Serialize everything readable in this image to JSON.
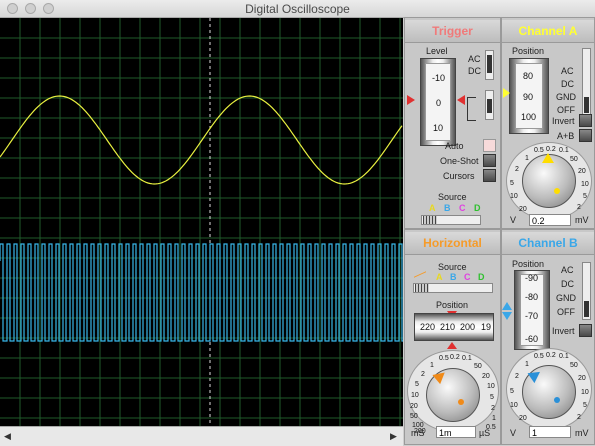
{
  "window": {
    "title": "Digital Oscilloscope"
  },
  "trigger": {
    "title": "Trigger",
    "level_label": "Level",
    "level_ticks": [
      "-10",
      "0",
      "10"
    ],
    "ac_label": "AC",
    "dc_label": "DC",
    "auto_label": "Auto",
    "oneshot_label": "One-Shot",
    "cursors_label": "Cursors",
    "source_label": "Source",
    "sources": [
      "A",
      "B",
      "C",
      "D"
    ]
  },
  "channel_a": {
    "title": "Channel A",
    "position_label": "Position",
    "position_ticks": [
      "80",
      "90",
      "100"
    ],
    "coupling": [
      "AC",
      "DC",
      "GND",
      "OFF"
    ],
    "invert_label": "Invert",
    "aplusb_label": "A+B",
    "scale": [
      "0.5",
      "0.2",
      "0.1",
      "1",
      "50",
      "2",
      "20",
      "5",
      "10",
      "10",
      "5",
      "20",
      "2"
    ],
    "unit_left": "V",
    "unit_right": "mV",
    "value": "0.2"
  },
  "horizontal": {
    "title": "Horizontal",
    "source_label": "Source",
    "sources": [
      "A",
      "B",
      "C",
      "D"
    ],
    "position_label": "Position",
    "position_ticks": [
      "220",
      "210",
      "200",
      "19"
    ],
    "scale": [
      "0.5",
      "0.2",
      "0.1",
      "1",
      "50",
      "2",
      "20",
      "5",
      "10",
      "10",
      "5",
      "20",
      "2",
      "50",
      "1",
      "100",
      "0.5",
      "200"
    ],
    "unit_left": "mS",
    "unit_right": "µS",
    "value": "1m"
  },
  "channel_b": {
    "title": "Channel B",
    "position_label": "Position",
    "position_ticks": [
      "-90",
      "-80",
      "-70",
      "-60"
    ],
    "coupling": [
      "AC",
      "DC",
      "GND",
      "OFF"
    ],
    "invert_label": "Invert",
    "scale": [
      "0.5",
      "0.2",
      "0.1",
      "1",
      "50",
      "2",
      "20",
      "5",
      "10",
      "10",
      "5",
      "20",
      "2"
    ],
    "unit_left": "V",
    "unit_right": "mV",
    "value": "1"
  },
  "colors": {
    "trigger": "#f07a7a",
    "channel_a": "#ffff33",
    "horizontal": "#f59b2a",
    "channel_b": "#3aa7e8",
    "grid": "#1f5a2a",
    "trace_a": "#e8f040",
    "trace_b": "#38b6e8",
    "cursor": "#ffffff"
  }
}
